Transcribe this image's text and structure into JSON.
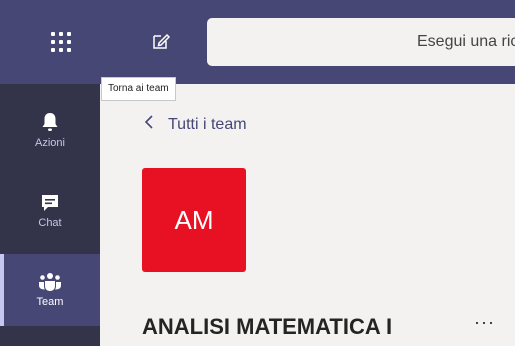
{
  "header": {
    "search_placeholder": "Esegui una ricerca o digita un comando"
  },
  "tooltip": {
    "text": "Torna ai team"
  },
  "rail": {
    "items": [
      {
        "label": "Azioni",
        "icon": "bell-icon"
      },
      {
        "label": "Chat",
        "icon": "chat-icon"
      },
      {
        "label": "Team",
        "icon": "team-icon",
        "active": true
      }
    ]
  },
  "main": {
    "back_label": "Tutti i team",
    "team_initials": "AM",
    "team_name": "ANALISI MATEMATICA I",
    "more_label": "···"
  },
  "colors": {
    "header_bg": "#464775",
    "rail_bg": "#33344a",
    "accent": "#464775",
    "team_avatar": "#e81123",
    "content_bg": "#f3f2f1"
  }
}
